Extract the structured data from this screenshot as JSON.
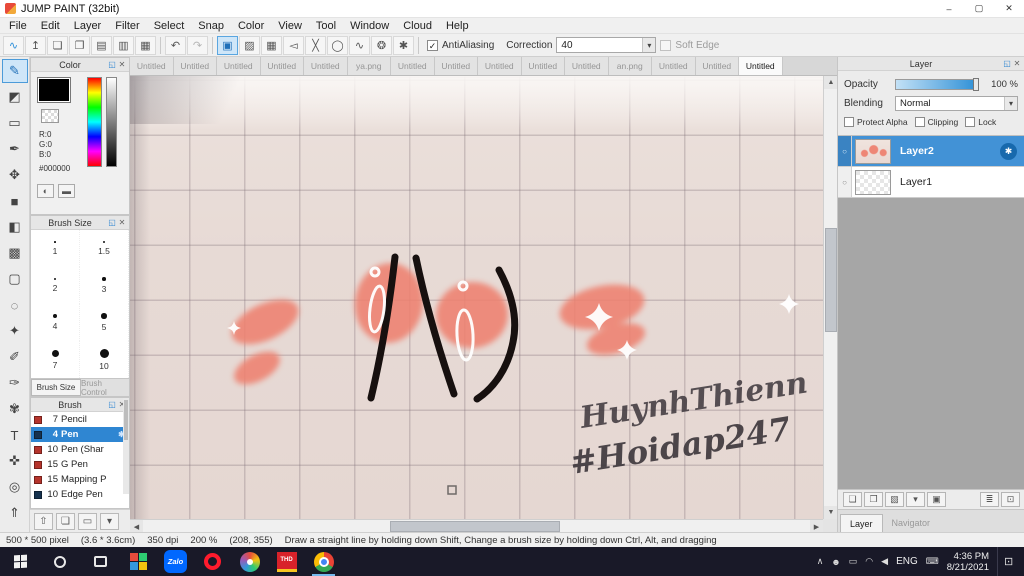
{
  "icons": {
    "chevron_down": "▾",
    "check": "✓",
    "popout": "◱",
    "close_small": "✕",
    "circle": "○",
    "gear": "✱",
    "scroll_up": "▲",
    "scroll_down": "▼",
    "scroll_left": "◀",
    "scroll_right": "▶",
    "keyboard": "⌨",
    "notification": "⊡"
  },
  "titlebar": {
    "title": "JUMP PAINT (32bit)",
    "minimize_glyph": "–",
    "maximize_glyph": "▢",
    "close_glyph": "✕"
  },
  "menubar": {
    "items": [
      "File",
      "Edit",
      "Layer",
      "Filter",
      "Select",
      "Snap",
      "Color",
      "View",
      "Tool",
      "Window",
      "Cloud",
      "Help"
    ]
  },
  "toolbar": {
    "group1": [
      {
        "name": "brush-stroke-icon",
        "glyph": "∿",
        "color": "#2e8fd8"
      },
      {
        "name": "export-icon",
        "glyph": "↥"
      },
      {
        "name": "comment-icon",
        "glyph": "❏"
      },
      {
        "name": "chat-icon",
        "glyph": "❐"
      },
      {
        "name": "pages-icon",
        "glyph": "▤"
      },
      {
        "name": "copy-pages-icon",
        "glyph": "▥"
      },
      {
        "name": "panel-grid-icon",
        "glyph": "▦"
      }
    ],
    "group2": [
      {
        "name": "undo-icon",
        "glyph": "↶"
      },
      {
        "name": "redo-icon",
        "glyph": "↷",
        "disabled": true
      }
    ],
    "group3": [
      {
        "name": "snap-off-icon",
        "glyph": "▣",
        "active": true
      },
      {
        "name": "snap-parallel-icon",
        "glyph": "▨"
      },
      {
        "name": "snap-grid-icon",
        "glyph": "▦"
      },
      {
        "name": "snap-horizontal-icon",
        "glyph": "◅"
      },
      {
        "name": "snap-cross-icon",
        "glyph": "╳"
      },
      {
        "name": "snap-ellipse-icon",
        "glyph": "◯"
      },
      {
        "name": "snap-curve-icon",
        "glyph": "∿"
      },
      {
        "name": "snap-radial-icon",
        "glyph": "❂"
      },
      {
        "name": "snap-settings-icon",
        "glyph": "✱"
      }
    ],
    "antialiasing_label": "AntiAliasing",
    "correction_label": "Correction",
    "correction_value": "40",
    "soft_edge_label": "Soft Edge"
  },
  "tool_strip": [
    {
      "name": "pen-tool-icon",
      "glyph": "✎",
      "active": true
    },
    {
      "name": "eraser-tool-icon",
      "glyph": "◩"
    },
    {
      "name": "shape-brush-tool-icon",
      "glyph": "▭"
    },
    {
      "name": "dip-pen-tool-icon",
      "glyph": "✒"
    },
    {
      "name": "move-tool-icon",
      "glyph": "✥"
    },
    {
      "name": "fill-rect-tool-icon",
      "glyph": "■"
    },
    {
      "name": "bucket-tool-icon",
      "glyph": "◧"
    },
    {
      "name": "gradient-tool-icon",
      "glyph": "▩"
    },
    {
      "name": "select-rect-tool-icon",
      "glyph": "▢"
    },
    {
      "name": "lasso-tool-icon",
      "glyph": "◌"
    },
    {
      "name": "magic-wand-tool-icon",
      "glyph": "✦"
    },
    {
      "name": "select-pen-tool-icon",
      "glyph": "✐"
    },
    {
      "name": "select-eraser-tool-icon",
      "glyph": "✑"
    },
    {
      "name": "filter-tool-icon",
      "glyph": "✾"
    },
    {
      "name": "text-tool-icon",
      "glyph": "T"
    },
    {
      "name": "hand-tool-icon",
      "glyph": "✜"
    },
    {
      "name": "zoom-tool-icon",
      "glyph": "◎"
    },
    {
      "name": "scroll-up-icon",
      "glyph": "⇑"
    }
  ],
  "color_panel": {
    "title": "Color",
    "r": "R:0",
    "g": "G:0",
    "b": "B:0",
    "hex": "#000000",
    "buttons": [
      {
        "name": "color-wheel-icon",
        "glyph": "◐"
      },
      {
        "name": "color-bar-icon",
        "glyph": "▬"
      }
    ]
  },
  "brush_size_panel": {
    "title": "Brush Size",
    "sizes": [
      "1",
      "1.5",
      "2",
      "3",
      "4",
      "5",
      "7",
      "10"
    ],
    "tab_active": "Brush Size",
    "tab_inactive": "Brush Control"
  },
  "brush_panel": {
    "title": "Brush",
    "brushes": [
      {
        "size": "7",
        "label": "Pencil",
        "chip": "#b5342c"
      },
      {
        "size": "4",
        "label": "Pen",
        "chip": "#16324f",
        "selected": true
      },
      {
        "size": "10",
        "label": "Pen (Shar",
        "chip": "#b5342c"
      },
      {
        "size": "15",
        "label": "G Pen",
        "chip": "#b5342c"
      },
      {
        "size": "15",
        "label": "Mapping P",
        "chip": "#b5342c"
      },
      {
        "size": "10",
        "label": "Edge Pen",
        "chip": "#16324f"
      }
    ]
  },
  "left_bottom_bar": [
    {
      "name": "upload-icon",
      "glyph": "⇧"
    },
    {
      "name": "new-canvas-icon",
      "glyph": "❏"
    },
    {
      "name": "open-folder-icon",
      "glyph": "▭"
    },
    {
      "name": "more-options-icon",
      "glyph": "▾"
    }
  ],
  "canvas": {
    "tabs": [
      {
        "label": "Untitled"
      },
      {
        "label": "Untitled"
      },
      {
        "label": "Untitled"
      },
      {
        "label": "Untitled"
      },
      {
        "label": "Untitled"
      },
      {
        "label": "ya.png"
      },
      {
        "label": "Untitled"
      },
      {
        "label": "Untitled"
      },
      {
        "label": "Untitled"
      },
      {
        "label": "Untitled"
      },
      {
        "label": "Untitled"
      },
      {
        "label": "an.png"
      },
      {
        "label": "Untitled"
      },
      {
        "label": "Untitled"
      },
      {
        "label": "Untitled",
        "active": true
      }
    ],
    "annotations": [
      "HuynhThienn",
      "#Hoidap247"
    ]
  },
  "layer_panel": {
    "title": "Layer",
    "opacity_label": "Opacity",
    "opacity_value": "100 %",
    "blending_label": "Blending",
    "blending_value": "Normal",
    "protect_alpha_label": "Protect Alpha",
    "clipping_label": "Clipping",
    "lock_label": "Lock",
    "layers": [
      {
        "name": "Layer2",
        "selected": true,
        "thumb": "art"
      },
      {
        "name": "Layer1",
        "thumb": "blank"
      }
    ],
    "bottom_icons_left": [
      {
        "name": "add-layer-icon",
        "glyph": "❏"
      },
      {
        "name": "duplicate-layer-icon",
        "glyph": "❐"
      },
      {
        "name": "import-image-icon",
        "glyph": "▧"
      },
      {
        "name": "layer-menu-icon",
        "glyph": "▾"
      },
      {
        "name": "folder-layer-icon",
        "glyph": "▣"
      }
    ],
    "bottom_icons_right": [
      {
        "name": "merge-layer-icon",
        "glyph": "≣"
      },
      {
        "name": "delete-layer-icon",
        "glyph": "⊡"
      }
    ],
    "tab_active": "Layer",
    "tab_inactive": "Navigator"
  },
  "status_bar": {
    "size": "500 * 500 pixel",
    "cm": "(3.6 * 3.6cm)",
    "dpi": "350 dpi",
    "zoom": "200 %",
    "coords": "(208, 355)",
    "hint": "Draw a straight line by holding down Shift, Change a brush size by holding down Ctrl, Alt, and dragging"
  },
  "taskbar": {
    "zalo_label": "Zalo",
    "thd_label": "THD",
    "lang": "ENG",
    "time": "4:36 PM",
    "date": "8/21/2021",
    "tray_icons": [
      {
        "name": "hidden-icons-icon",
        "glyph": "∧"
      },
      {
        "name": "contact-icon",
        "glyph": "☻"
      },
      {
        "name": "battery-icon",
        "glyph": "▭"
      },
      {
        "name": "network-icon",
        "glyph": "◠"
      },
      {
        "name": "volume-icon",
        "glyph": "◀"
      }
    ]
  }
}
